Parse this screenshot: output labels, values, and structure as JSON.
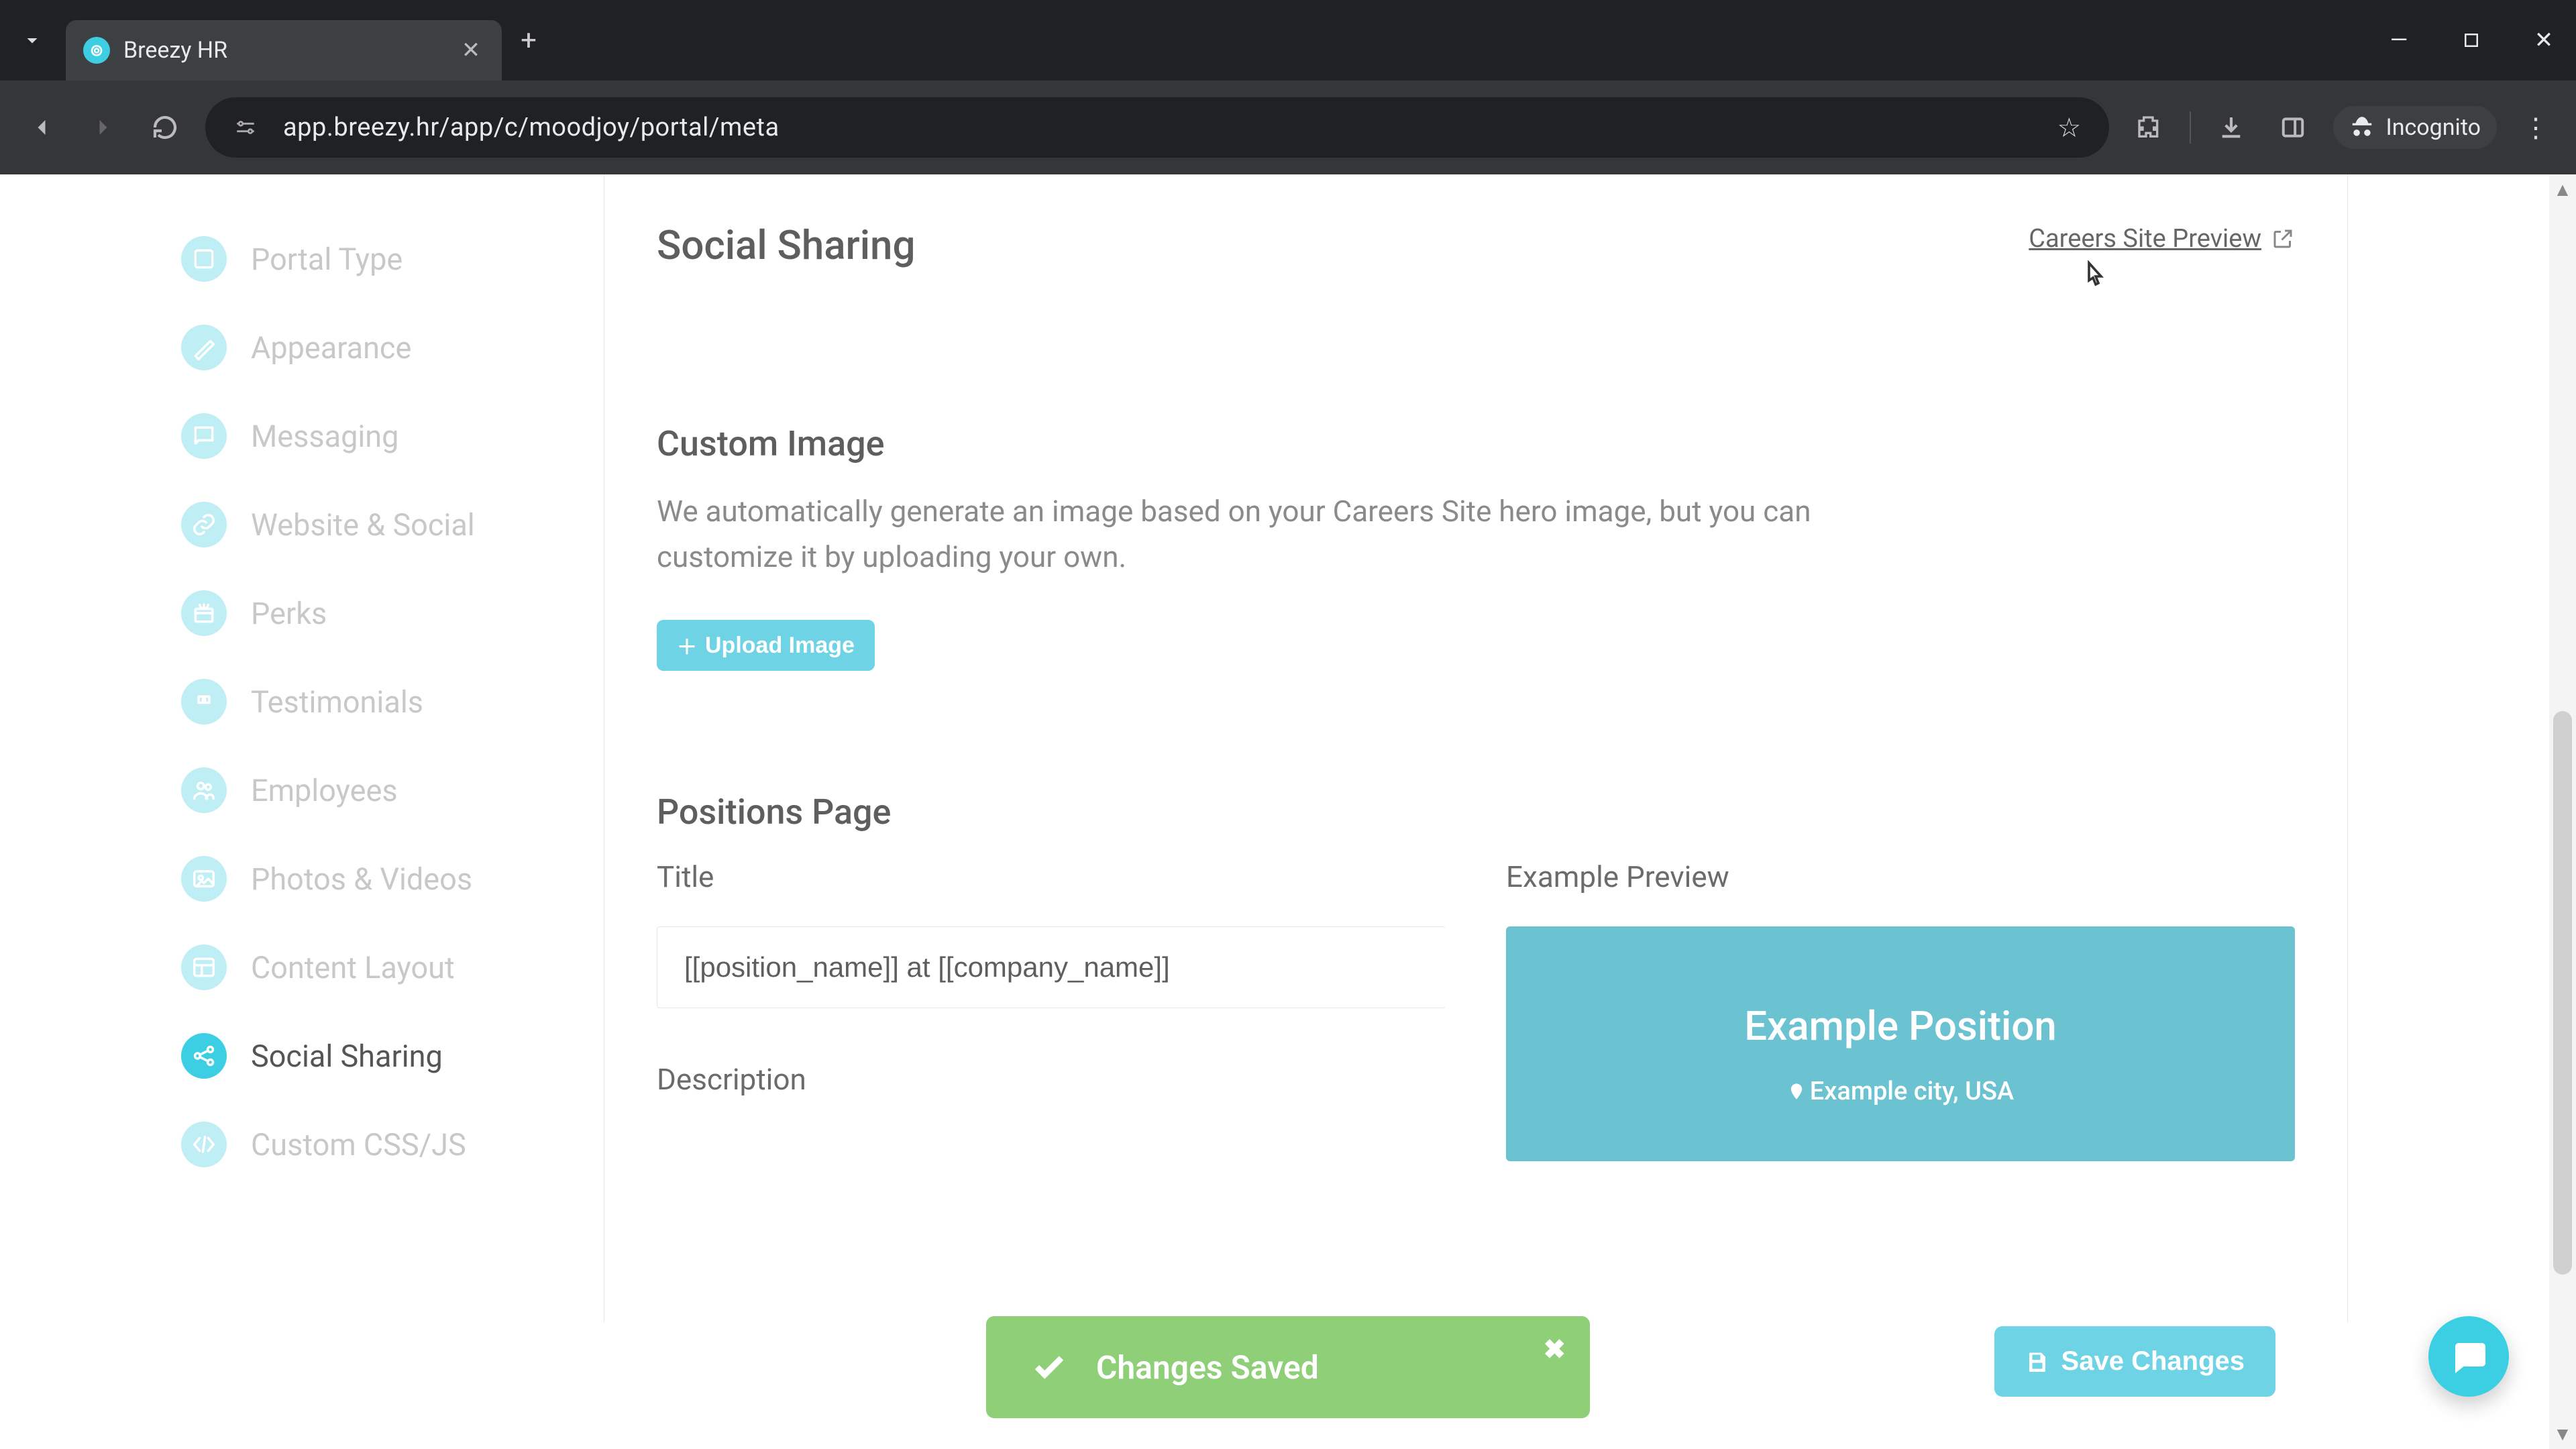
{
  "browser": {
    "tab_title": "Breezy HR",
    "url": "app.breezy.hr/app/c/moodjoy/portal/meta",
    "incognito_label": "Incognito"
  },
  "sidebar": {
    "items": [
      {
        "label": "Portal Type",
        "icon": "portal-type-icon"
      },
      {
        "label": "Appearance",
        "icon": "appearance-icon"
      },
      {
        "label": "Messaging",
        "icon": "messaging-icon"
      },
      {
        "label": "Website & Social",
        "icon": "link-icon"
      },
      {
        "label": "Perks",
        "icon": "perks-icon"
      },
      {
        "label": "Testimonials",
        "icon": "quote-icon"
      },
      {
        "label": "Employees",
        "icon": "people-icon"
      },
      {
        "label": "Photos & Videos",
        "icon": "photo-icon"
      },
      {
        "label": "Content Layout",
        "icon": "layout-icon"
      },
      {
        "label": "Social Sharing",
        "icon": "share-icon"
      },
      {
        "label": "Custom CSS/JS",
        "icon": "code-icon"
      }
    ],
    "active_index": 9
  },
  "main": {
    "title": "Social Sharing",
    "preview_link": "Careers Site Preview",
    "custom_image": {
      "heading": "Custom Image",
      "description": "We automatically generate an image based on your Careers Site hero image, but you can customize it by uploading your own.",
      "upload_button": "Upload Image"
    },
    "positions_page": {
      "heading": "Positions Page",
      "title_label": "Title",
      "title_value": "[[position_name]] at [[company_name]]",
      "description_label": "Description",
      "preview_label": "Example Preview",
      "preview_card": {
        "title": "Example Position",
        "location": "Example city, USA"
      }
    }
  },
  "toast": {
    "message": "Changes Saved"
  },
  "buttons": {
    "save": "Save Changes"
  }
}
